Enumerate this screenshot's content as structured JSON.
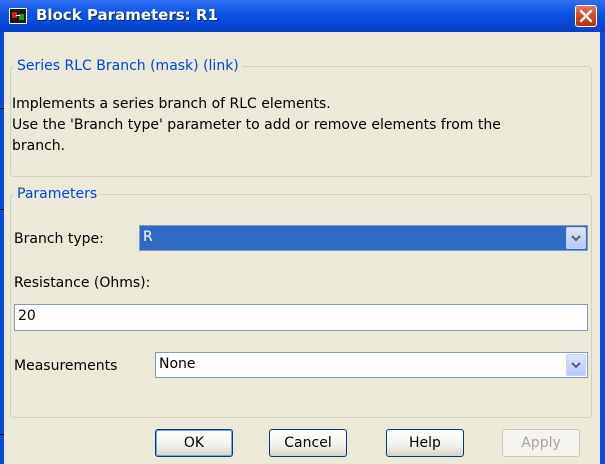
{
  "window": {
    "title": "Block Parameters: R1"
  },
  "mask": {
    "legend": "Series RLC Branch (mask) (link)",
    "description_lines": [
      "Implements a series branch of RLC elements.",
      "Use the 'Branch type' parameter to add or remove elements from the",
      "branch."
    ]
  },
  "parameters": {
    "legend": "Parameters",
    "branch_type_label": "Branch type:",
    "branch_type_value": "R",
    "resistance_label": "Resistance (Ohms):",
    "resistance_value": "20",
    "measurements_label": "Measurements",
    "measurements_value": "None"
  },
  "buttons": {
    "ok": "OK",
    "cancel": "Cancel",
    "help": "Help",
    "apply": "Apply"
  },
  "colors": {
    "title_bar": "#0a4ad8",
    "legend_text": "#0046d5",
    "selection": "#316ac5",
    "dialog_face": "#ece9d8"
  }
}
